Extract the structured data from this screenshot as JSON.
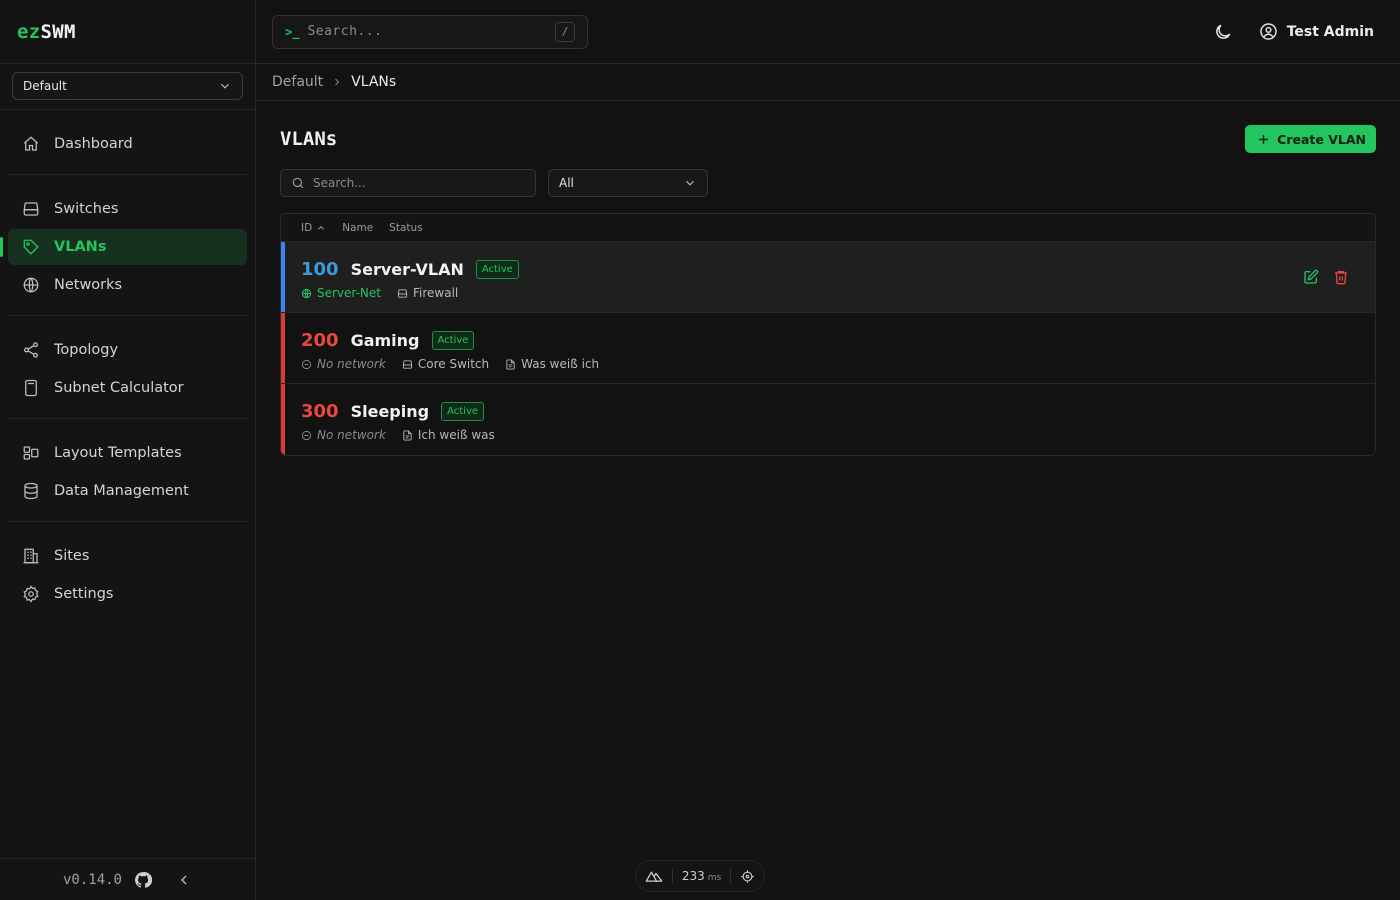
{
  "brand": {
    "prefix": "ez",
    "name": "SWM"
  },
  "site_selector": {
    "value": "Default"
  },
  "nav": {
    "groups": [
      [
        {
          "label": "Dashboard",
          "icon": "home-icon"
        }
      ],
      [
        {
          "label": "Switches",
          "icon": "server-icon"
        },
        {
          "label": "VLANs",
          "icon": "tag-icon",
          "active": true
        },
        {
          "label": "Networks",
          "icon": "globe-icon"
        }
      ],
      [
        {
          "label": "Topology",
          "icon": "share-icon"
        },
        {
          "label": "Subnet Calculator",
          "icon": "calculator-icon"
        }
      ],
      [
        {
          "label": "Layout Templates",
          "icon": "layout-icon"
        },
        {
          "label": "Data Management",
          "icon": "database-icon"
        }
      ],
      [
        {
          "label": "Sites",
          "icon": "building-icon"
        },
        {
          "label": "Settings",
          "icon": "gear-icon"
        }
      ]
    ]
  },
  "footer": {
    "version": "v0.14.0"
  },
  "topbar": {
    "search_prompt": ">_",
    "search_placeholder": "Search...",
    "search_shortcut": "/",
    "user_name": "Test Admin"
  },
  "breadcrumb": {
    "parent": "Default",
    "current": "VLANs"
  },
  "page": {
    "title": "VLANs",
    "create_label": "Create VLAN",
    "search_placeholder": "Search...",
    "status_filter": "All"
  },
  "table": {
    "columns": [
      "ID",
      "Name",
      "Status"
    ],
    "rows": [
      {
        "id": "100",
        "name": "Server-VLAN",
        "status": "Active",
        "network": "Server-Net",
        "switch": "Firewall",
        "description": ""
      },
      {
        "id": "200",
        "name": "Gaming",
        "status": "Active",
        "network": "No network",
        "switch": "Core Switch",
        "description": "Was weiß ich"
      },
      {
        "id": "300",
        "name": "Sleeping",
        "status": "Active",
        "network": "No network",
        "switch": "",
        "description": "Ich weiß was"
      }
    ]
  },
  "devtools": {
    "ms_value": "233",
    "ms_unit": "ms"
  },
  "colors": {
    "accent": "#22c55e",
    "vlan_blue": "#3b9bd9",
    "vlan_red": "#e8493b",
    "danger": "#ef4444"
  }
}
